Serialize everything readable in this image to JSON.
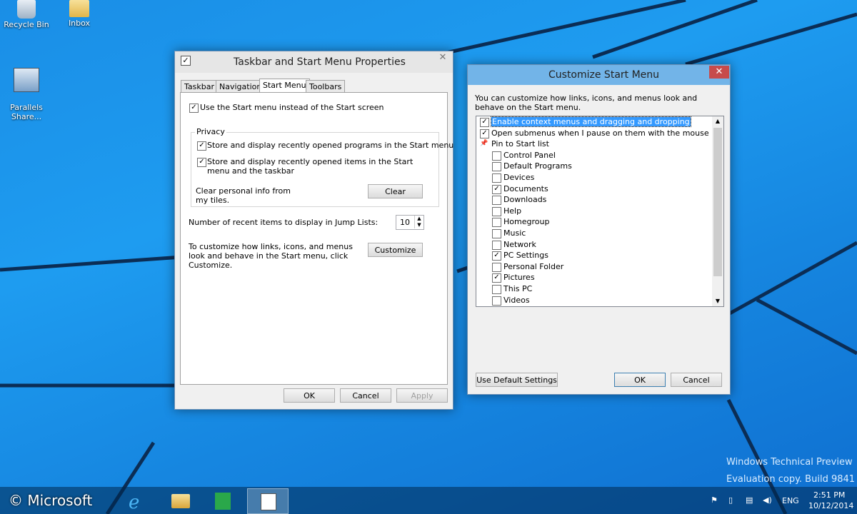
{
  "desktop": {
    "icons": [
      {
        "label": "Recycle Bin",
        "icon": "recycle-bin-icon"
      },
      {
        "label": "Inbox",
        "icon": "folder-icon"
      },
      {
        "label": "Parallels\nShare...",
        "icon": "network-share-icon"
      }
    ],
    "watermark": {
      "line1": "Windows Technical Preview",
      "line2": "Evaluation copy. Build 9841"
    },
    "copyright": "© Microsoft"
  },
  "taskbar_props": {
    "title": "Taskbar and Start Menu Properties",
    "close": "✕",
    "tabs": [
      "Taskbar",
      "Navigation",
      "Start Menu",
      "Toolbars"
    ],
    "active_tab": "Start Menu",
    "use_start_menu": {
      "label": "Use the Start menu instead of the Start screen",
      "checked": true
    },
    "privacy_group": "Privacy",
    "store_programs": {
      "label": "Store and display recently opened programs in the Start menu",
      "checked": true
    },
    "store_items": {
      "label": "Store and display recently opened items in the Start menu and the taskbar",
      "checked": true
    },
    "clear_text": "Clear personal info from my tiles.",
    "clear_button": "Clear",
    "jump_label": "Number of recent items to display in Jump Lists:",
    "jump_value": "10",
    "customize_text": "To customize how links, icons, and menus look and behave in the Start menu, click Customize.",
    "customize_button": "Customize",
    "ok": "OK",
    "cancel": "Cancel",
    "apply": "Apply"
  },
  "customize": {
    "title": "Customize Start Menu",
    "close": "✕",
    "description": "You can customize how links, icons, and menus look and behave on the Start menu.",
    "items": [
      {
        "label": "Enable context menus and dragging and dropping",
        "checked": true,
        "indent": 0,
        "selected": true
      },
      {
        "label": "Open submenus when I pause on them with the mouse pointer",
        "checked": true,
        "indent": 0
      },
      {
        "label": "Pin to Start list",
        "checked": null,
        "indent": 0,
        "icon": "pin-icon"
      },
      {
        "label": "Control Panel",
        "checked": false,
        "indent": 1
      },
      {
        "label": "Default Programs",
        "checked": false,
        "indent": 1
      },
      {
        "label": "Devices",
        "checked": false,
        "indent": 1
      },
      {
        "label": "Documents",
        "checked": true,
        "indent": 1
      },
      {
        "label": "Downloads",
        "checked": false,
        "indent": 1
      },
      {
        "label": "Help",
        "checked": false,
        "indent": 1
      },
      {
        "label": "Homegroup",
        "checked": false,
        "indent": 1
      },
      {
        "label": "Music",
        "checked": false,
        "indent": 1
      },
      {
        "label": "Network",
        "checked": false,
        "indent": 1
      },
      {
        "label": "PC Settings",
        "checked": true,
        "indent": 1
      },
      {
        "label": "Personal Folder",
        "checked": false,
        "indent": 1
      },
      {
        "label": "Pictures",
        "checked": true,
        "indent": 1
      },
      {
        "label": "This PC",
        "checked": false,
        "indent": 1
      },
      {
        "label": "Videos",
        "checked": false,
        "indent": 1
      }
    ],
    "default_button": "Use Default Settings",
    "ok": "OK",
    "cancel": "Cancel"
  },
  "taskbar": {
    "apps": [
      "windows-start-icon",
      "internet-explorer-icon",
      "file-explorer-icon",
      "store-icon",
      "taskbar-properties-icon"
    ],
    "lang": "ENG",
    "time": "2:51 PM",
    "date": "10/12/2014"
  }
}
